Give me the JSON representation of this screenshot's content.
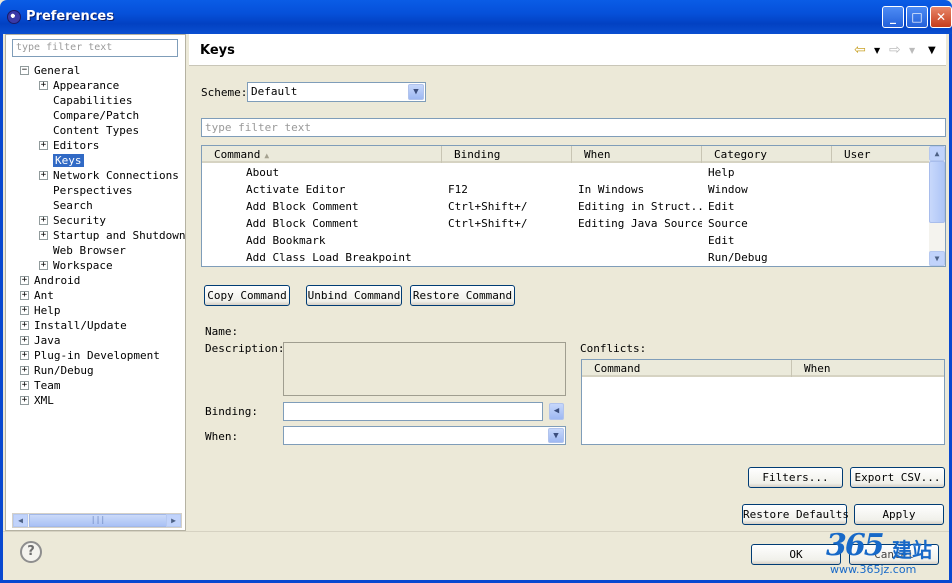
{
  "window": {
    "title": "Preferences"
  },
  "left": {
    "filter_placeholder": "type filter text",
    "tree": [
      {
        "label": "General",
        "expander": "−"
      },
      {
        "label": "Appearance",
        "expander": "+"
      },
      {
        "label": "Capabilities",
        "expander": ""
      },
      {
        "label": "Compare/Patch",
        "expander": ""
      },
      {
        "label": "Content Types",
        "expander": ""
      },
      {
        "label": "Editors",
        "expander": "+"
      },
      {
        "label": "Keys",
        "expander": ""
      },
      {
        "label": "Network Connections",
        "expander": "+"
      },
      {
        "label": "Perspectives",
        "expander": ""
      },
      {
        "label": "Search",
        "expander": ""
      },
      {
        "label": "Security",
        "expander": "+"
      },
      {
        "label": "Startup and Shutdown",
        "expander": "+"
      },
      {
        "label": "Web Browser",
        "expander": ""
      },
      {
        "label": "Workspace",
        "expander": "+"
      },
      {
        "label": "Android",
        "expander": "+"
      },
      {
        "label": "Ant",
        "expander": "+"
      },
      {
        "label": "Help",
        "expander": "+"
      },
      {
        "label": "Install/Update",
        "expander": "+"
      },
      {
        "label": "Java",
        "expander": "+"
      },
      {
        "label": "Plug-in Development",
        "expander": "+"
      },
      {
        "label": "Run/Debug",
        "expander": "+"
      },
      {
        "label": "Team",
        "expander": "+"
      },
      {
        "label": "XML",
        "expander": "+"
      }
    ]
  },
  "page": {
    "title": "Keys",
    "scheme_label": "Scheme:",
    "scheme_value": "Default",
    "filter_placeholder": "type filter text",
    "columns": [
      "Command",
      "Binding",
      "When",
      "Category",
      "User"
    ],
    "rows": [
      {
        "command": "About",
        "binding": "",
        "when": "",
        "category": "Help",
        "user": ""
      },
      {
        "command": "Activate Editor",
        "binding": "F12",
        "when": "In Windows",
        "category": "Window",
        "user": ""
      },
      {
        "command": "Add Block Comment",
        "binding": "Ctrl+Shift+/",
        "when": "Editing in Struct...",
        "category": "Edit",
        "user": ""
      },
      {
        "command": "Add Block Comment",
        "binding": "Ctrl+Shift+/",
        "when": "Editing Java Source",
        "category": "Source",
        "user": ""
      },
      {
        "command": "Add Bookmark",
        "binding": "",
        "when": "",
        "category": "Edit",
        "user": ""
      },
      {
        "command": "Add Class Load Breakpoint",
        "binding": "",
        "when": "",
        "category": "Run/Debug",
        "user": ""
      }
    ],
    "copy_command": "Copy Command",
    "unbind_command": "Unbind Command",
    "restore_command": "Restore Command",
    "name_label": "Name:",
    "description_label": "Description:",
    "binding_label": "Binding:",
    "when_label": "When:",
    "conflicts_label": "Conflicts:",
    "conflicts_columns": [
      "Command",
      "When"
    ],
    "filters_button": "Filters...",
    "export_button": "Export CSV...",
    "restore_defaults": "Restore Defaults",
    "apply": "Apply"
  },
  "footer": {
    "ok": "OK",
    "cancel": "Cancel"
  },
  "watermark": {
    "logo": "365",
    "cn": "建站",
    "url": "www.365jz.com"
  },
  "icons": {
    "help": "?",
    "back": "⇦",
    "forward": "⇨",
    "menu": "▼"
  }
}
